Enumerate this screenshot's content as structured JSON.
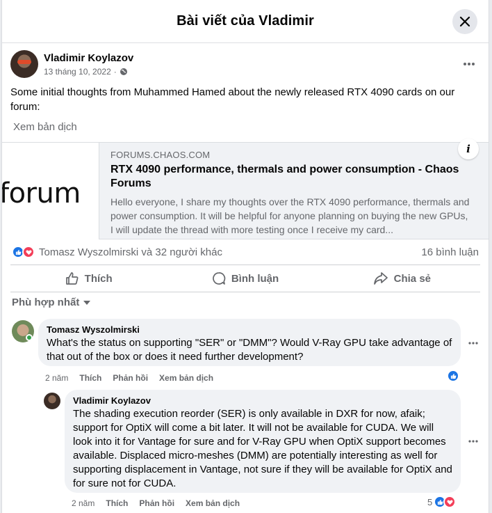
{
  "modal": {
    "title": "Bài viết của Vladimir"
  },
  "post": {
    "author": "Vladimir Koylazov",
    "date": "13 tháng 10, 2022",
    "privacy_icon": "globe-icon",
    "text": "Some initial thoughts from Muhammed Hamed about the newly released RTX 4090 cards on our forum:",
    "translate_label": "Xem bản dịch"
  },
  "link_card": {
    "thumb_text": "forum",
    "domain": "FORUMS.CHAOS.COM",
    "title": "RTX 4090 performance, thermals and power consumption - Chaos Forums",
    "description": "Hello everyone, I share my thoughts over the RTX 4090 performance, thermals and power consumption. It will be helpful for anyone planning on buying the new GPUs, I will update the thread with more testing once I receive my card...",
    "info_label": "i"
  },
  "reactions": {
    "summary": "Tomasz Wyszolmirski và 32 người khác",
    "comment_count": "16 bình luận",
    "icons": [
      "like-icon",
      "love-icon"
    ]
  },
  "actions": {
    "like": "Thích",
    "comment": "Bình luận",
    "share": "Chia sẻ"
  },
  "sort": {
    "label": "Phù hợp nhất"
  },
  "comments": [
    {
      "author": "Tomasz Wyszolmirski",
      "text": "What's the status on supporting \"SER\" or \"DMM\"? Would V-Ray GPU take advantage of that out of the box or does it need further development?",
      "time": "2 năm",
      "like": "Thích",
      "reply": "Phản hồi",
      "translate": "Xem bản dịch"
    },
    {
      "author": "Vladimir Koylazov",
      "text": "The shading execution reorder (SER) is only available in DXR for now, afaik; support for OptiX will come a bit later. It will not be available for CUDA. We will look into it for Vantage for sure and for V-Ray GPU when OptiX support becomes available. Displaced micro-meshes (DMM) are potentially interesting as well for supporting displacement in Vantage, not sure if they will be available for OptiX and for sure not for CUDA.",
      "time": "2 năm",
      "like": "Thích",
      "reply": "Phản hồi",
      "translate": "Xem bản dịch",
      "reaction_count": "5"
    }
  ],
  "colors": {
    "accent": "#1b74e4",
    "love": "#f33e58",
    "muted": "#65676b",
    "bubble": "#f0f2f5",
    "online": "#31a24c"
  }
}
